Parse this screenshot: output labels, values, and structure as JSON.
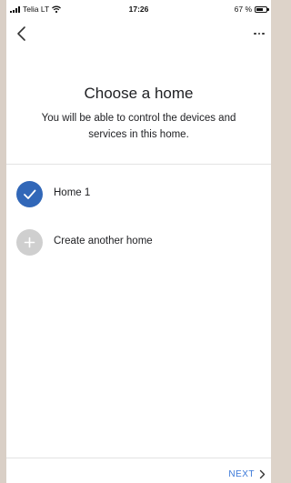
{
  "status_bar": {
    "carrier": "Telia LT",
    "time": "17:26",
    "battery": "67 %",
    "battery_level": 0.67
  },
  "app_bar": {
    "back_icon": "chevron-left-icon",
    "more_icon": "more-horizontal-icon"
  },
  "header": {
    "title": "Choose a home",
    "subtitle": "You will be able to control the devices and services in this home."
  },
  "homes": [
    {
      "label": "Home 1",
      "selected": true,
      "icon": "check-icon"
    },
    {
      "label": "Create another home",
      "selected": false,
      "icon": "plus-icon"
    }
  ],
  "footer": {
    "next_label": "NEXT",
    "next_icon": "chevron-right-icon"
  },
  "colors": {
    "accent": "#3167b8",
    "link": "#3a78d8",
    "inactive_circle": "#cfcfcf"
  }
}
